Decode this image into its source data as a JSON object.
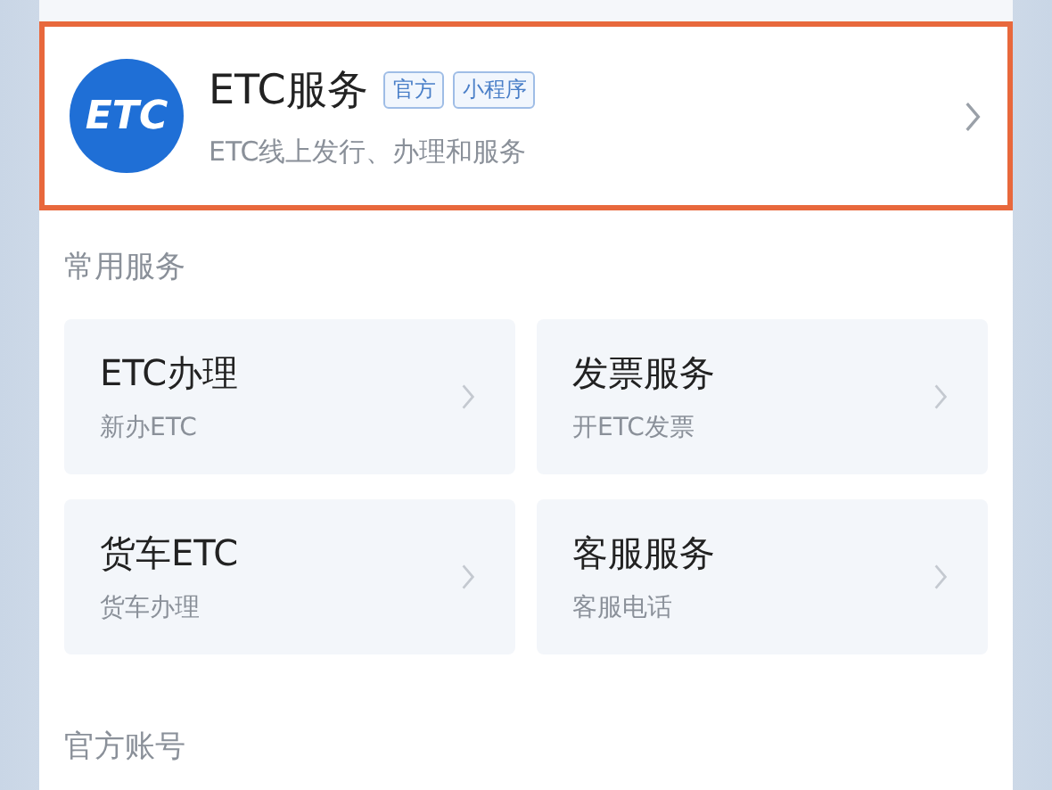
{
  "mini_program": {
    "logo": "ETC",
    "title": "ETC服务",
    "badges": [
      "官方",
      "小程序"
    ],
    "subtitle": "ETC线上发行、办理和服务",
    "highlighted": true
  },
  "common_services": {
    "heading": "常用服务",
    "items": [
      {
        "title": "ETC办理",
        "subtitle": "新办ETC"
      },
      {
        "title": "发票服务",
        "subtitle": "开ETC发票"
      },
      {
        "title": "货车ETC",
        "subtitle": "货车办理"
      },
      {
        "title": "客服服务",
        "subtitle": "客服电话"
      }
    ]
  },
  "official_accounts": {
    "heading": "官方账号"
  }
}
